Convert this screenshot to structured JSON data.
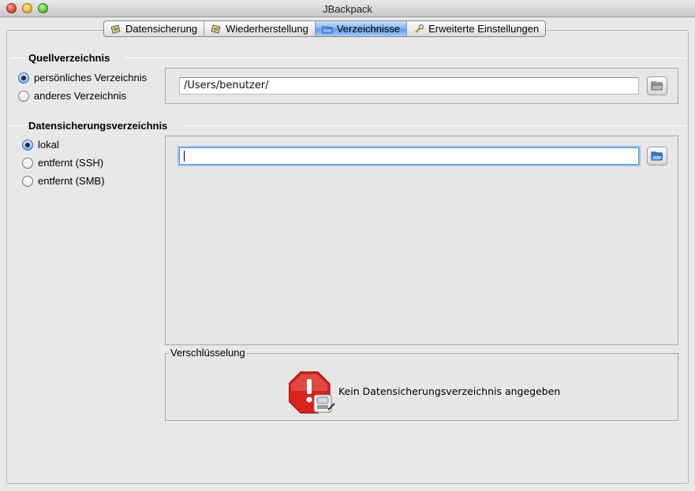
{
  "window": {
    "title": "JBackpack"
  },
  "tabs": [
    {
      "label": "Datensicherung",
      "icon": "backup-icon",
      "active": false
    },
    {
      "label": "Wiederherstellung",
      "icon": "restore-icon",
      "active": false
    },
    {
      "label": "Verzeichnisse",
      "icon": "folder-icon",
      "active": true
    },
    {
      "label": "Erweiterte Einstellungen",
      "icon": "wrench-icon",
      "active": false
    }
  ],
  "source": {
    "title": "Quellverzeichnis",
    "options": [
      {
        "label": "persönliches Verzeichnis",
        "selected": true
      },
      {
        "label": "anderes Verzeichnis",
        "selected": false
      }
    ],
    "path": "/Users/benutzer/",
    "browse_icon": "folder-open-icon"
  },
  "destination": {
    "title": "Datensicherungsverzeichnis",
    "options": [
      {
        "label": "lokal",
        "selected": true
      },
      {
        "label": "entfernt (SSH)",
        "selected": false
      },
      {
        "label": "entfernt (SMB)",
        "selected": false
      }
    ],
    "path": "",
    "browse_icon": "folder-open-icon"
  },
  "encryption": {
    "legend": "Verschlüsselung",
    "status_icon": "stop-warning-icon",
    "message": "Kein Datensicherungsverzeichnis angegeben"
  },
  "colors": {
    "accent": "#5e98e6",
    "warning": "#d8221c"
  }
}
